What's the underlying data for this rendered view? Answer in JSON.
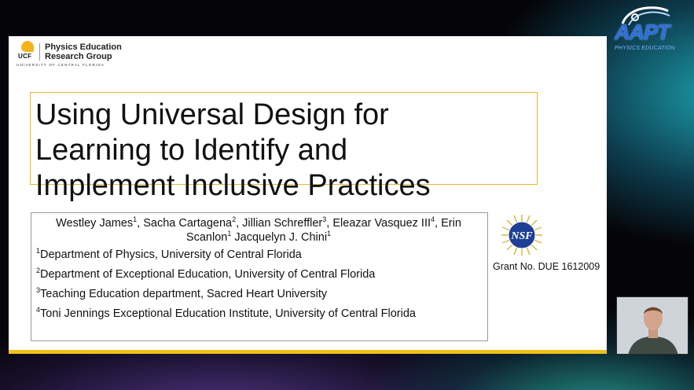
{
  "slide": {
    "logo": {
      "mark_text": "UCF",
      "name": "Physics Education\nResearch Group",
      "university": "UNIVERSITY OF CENTRAL FLORIDA"
    },
    "title": "Using Universal Design for\nLearning to Identify and\nImplement Inclusive Practices",
    "authors": [
      {
        "name": "Westley James",
        "sup": "1"
      },
      {
        "name": "Sacha Cartagena",
        "sup": "2"
      },
      {
        "name": "Jillian Schreffler",
        "sup": "3"
      },
      {
        "name": "Eleazar Vasquez III",
        "sup": "4"
      },
      {
        "name": "Erin Scanlon",
        "sup": "1"
      },
      {
        "name": "Jacquelyn J. Chini",
        "sup": "1"
      }
    ],
    "affiliations": [
      {
        "num": "1",
        "text": "Department of Physics, University of Central Florida"
      },
      {
        "num": "2",
        "text": "Department of Exceptional Education, University of Central Florida"
      },
      {
        "num": "3",
        "text": "Teaching Education department, Sacred Heart University"
      },
      {
        "num": "4",
        "text": "Toni Jennings Exceptional Education Institute, University of Central Florida"
      }
    ],
    "nsf_label": "NSF",
    "grant": "Grant No. DUE 1612009",
    "accent_color": "#f2c01e"
  },
  "overlay": {
    "aapt_logo": "AAPT",
    "aapt_subtitle": "PHYSICS EDUCATION",
    "aapt_color": "#2e6fe0"
  },
  "webcam": {
    "icon": "presenter-video"
  }
}
